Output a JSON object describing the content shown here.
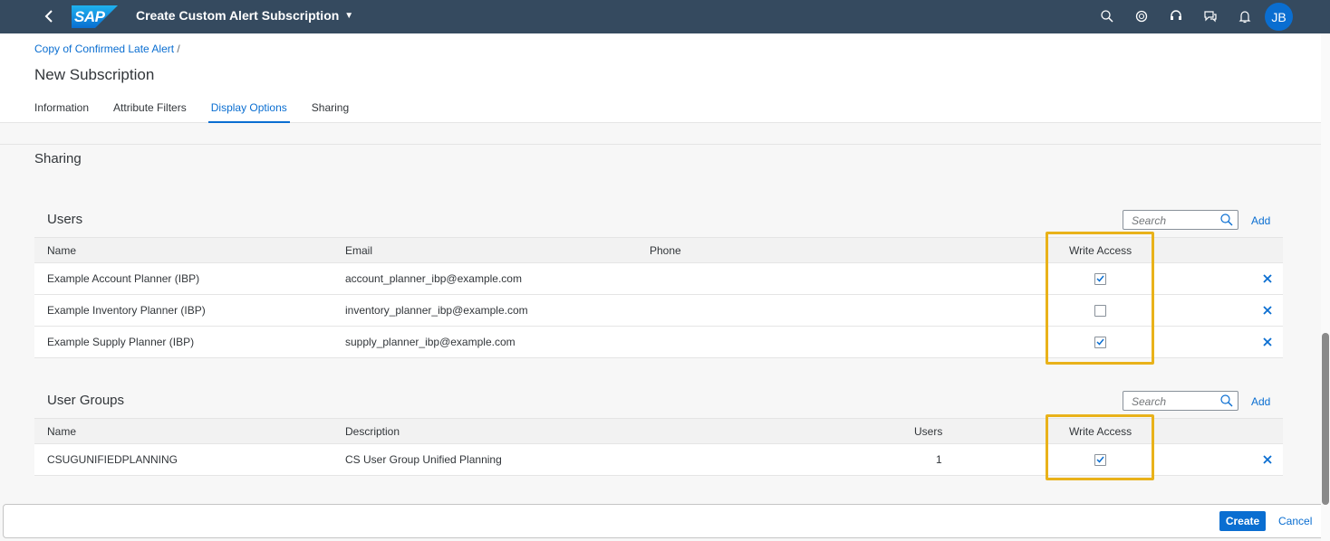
{
  "shell": {
    "logo_text": "SAP",
    "title": "Create Custom Alert Subscription",
    "avatar_initials": "JB"
  },
  "header": {
    "breadcrumb": "Copy of Confirmed Late Alert",
    "breadcrumb_sep": "/",
    "title": "New Subscription",
    "tabs": [
      "Information",
      "Attribute Filters",
      "Display Options",
      "Sharing"
    ],
    "active_tab": "Display Options"
  },
  "sharing": {
    "title": "Sharing",
    "users": {
      "title": "Users",
      "search_placeholder": "Search",
      "add_label": "Add",
      "columns": [
        "Name",
        "Email",
        "Phone",
        "Write Access"
      ],
      "rows": [
        {
          "name": "Example Account Planner (IBP)",
          "email": "account_planner_ibp@example.com",
          "phone": "",
          "write_access": true
        },
        {
          "name": "Example Inventory Planner (IBP)",
          "email": "inventory_planner_ibp@example.com",
          "phone": "",
          "write_access": false
        },
        {
          "name": "Example Supply Planner (IBP)",
          "email": "supply_planner_ibp@example.com",
          "phone": "",
          "write_access": true
        }
      ]
    },
    "groups": {
      "title": "User Groups",
      "search_placeholder": "Search",
      "add_label": "Add",
      "columns": [
        "Name",
        "Description",
        "Users",
        "Write Access"
      ],
      "rows": [
        {
          "name": "CSUGUNIFIEDPLANNING",
          "description": "CS User Group Unified Planning",
          "users": "1",
          "write_access": true
        }
      ]
    }
  },
  "footer": {
    "create_label": "Create",
    "cancel_label": "Cancel"
  },
  "colors": {
    "shell_bg": "#354a5f",
    "accent": "#0a6ed1",
    "highlight": "#e9b21a"
  }
}
